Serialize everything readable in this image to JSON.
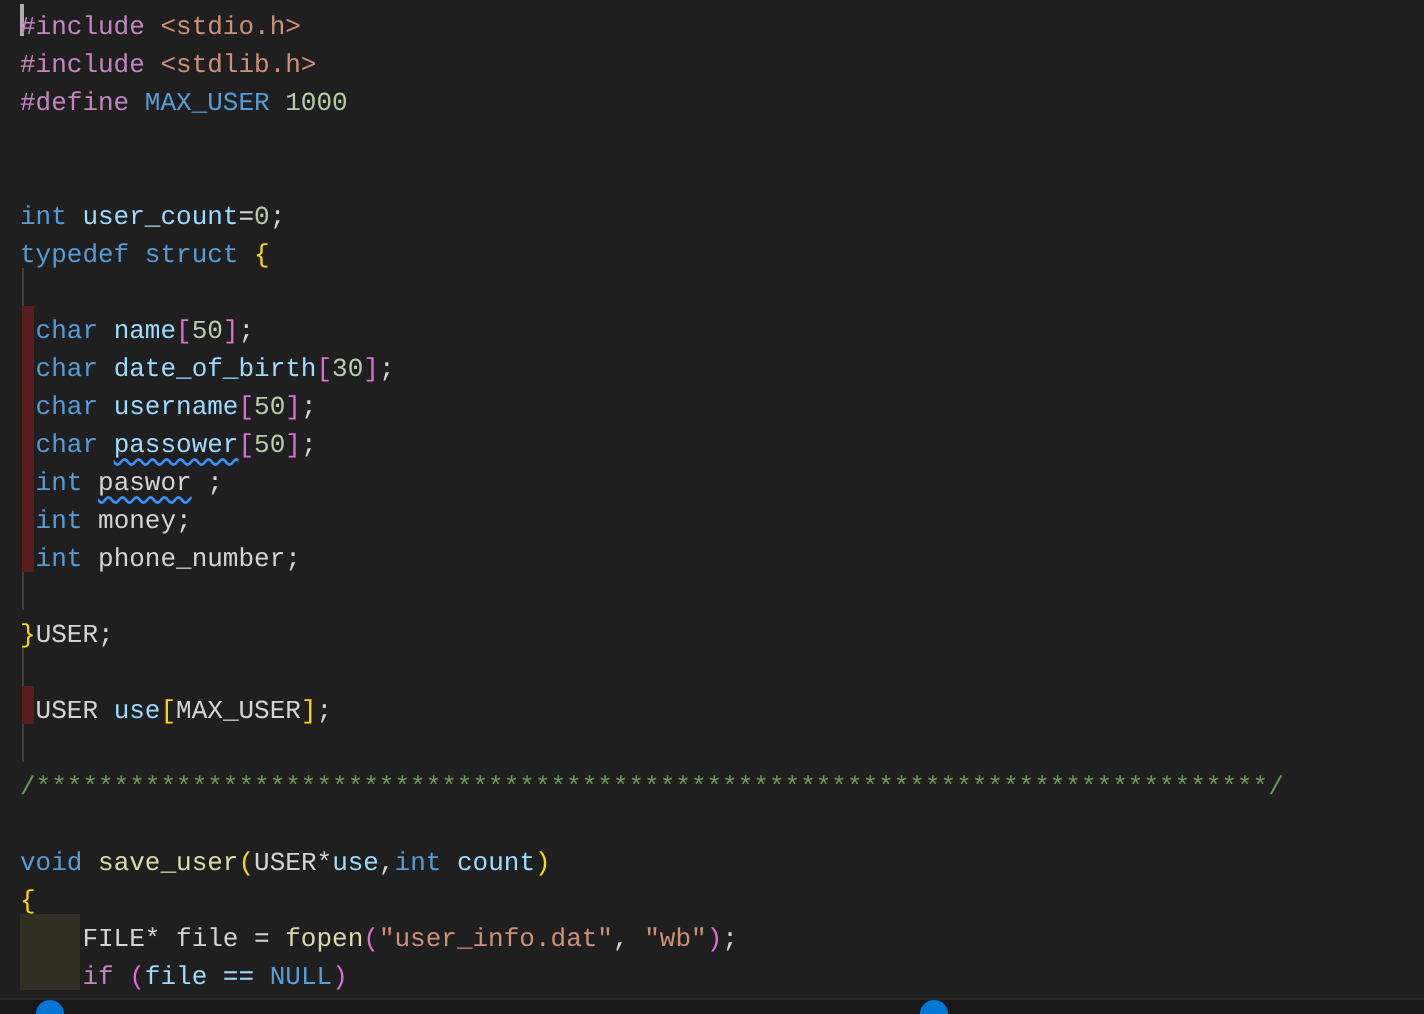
{
  "editor": {
    "lines": [
      {
        "kind": "code",
        "current": true,
        "tokens": [
          {
            "t": "#include",
            "kind": "pp"
          },
          {
            "t": " <stdio.h>",
            "kind": "str"
          }
        ]
      },
      {
        "kind": "code",
        "tokens": [
          {
            "t": "#include",
            "kind": "pp"
          },
          {
            "t": " <stdlib.h>",
            "kind": "str"
          }
        ]
      },
      {
        "kind": "code",
        "tokens": [
          {
            "t": "#define",
            "kind": "pp"
          },
          {
            "t": " MAX_USER",
            "kind": "macro"
          },
          {
            "t": " 1000",
            "kind": "num"
          }
        ]
      },
      {
        "kind": "blank"
      },
      {
        "kind": "blank"
      },
      {
        "kind": "code",
        "tokens": [
          {
            "t": "int",
            "kind": "kw"
          },
          {
            "t": " user_count",
            "kind": "id"
          },
          {
            "t": "=",
            "kind": "plain"
          },
          {
            "t": "0",
            "kind": "num"
          },
          {
            "t": ";",
            "kind": "plain"
          }
        ]
      },
      {
        "kind": "code",
        "tokens": [
          {
            "t": "typedef",
            "kind": "kw"
          },
          {
            "t": " struct",
            "kind": "kw"
          },
          {
            "t": " {",
            "kind": "br1"
          }
        ]
      },
      {
        "kind": "blank",
        "guide": true
      },
      {
        "kind": "code",
        "guide": true,
        "modified": true,
        "tokens": [
          {
            "t": " char",
            "kind": "kw"
          },
          {
            "t": " name",
            "kind": "id"
          },
          {
            "t": "[",
            "kind": "br2"
          },
          {
            "t": "50",
            "kind": "num"
          },
          {
            "t": "]",
            "kind": "br2"
          },
          {
            "t": ";",
            "kind": "plain"
          }
        ]
      },
      {
        "kind": "code",
        "guide": true,
        "modified": true,
        "tokens": [
          {
            "t": " char",
            "kind": "kw"
          },
          {
            "t": " date_of_birth",
            "kind": "id"
          },
          {
            "t": "[",
            "kind": "br2"
          },
          {
            "t": "30",
            "kind": "num"
          },
          {
            "t": "]",
            "kind": "br2"
          },
          {
            "t": ";",
            "kind": "plain"
          }
        ]
      },
      {
        "kind": "code",
        "guide": true,
        "modified": true,
        "tokens": [
          {
            "t": " char",
            "kind": "kw"
          },
          {
            "t": " username",
            "kind": "id"
          },
          {
            "t": "[",
            "kind": "br2"
          },
          {
            "t": "50",
            "kind": "num"
          },
          {
            "t": "]",
            "kind": "br2"
          },
          {
            "t": ";",
            "kind": "plain"
          }
        ]
      },
      {
        "kind": "code",
        "guide": true,
        "modified": true,
        "tokens": [
          {
            "t": " char ",
            "kind": "kw"
          },
          {
            "t": "passower",
            "kind": "id",
            "squiggle": true
          },
          {
            "t": "[",
            "kind": "br2"
          },
          {
            "t": "50",
            "kind": "num"
          },
          {
            "t": "]",
            "kind": "br2"
          },
          {
            "t": ";",
            "kind": "plain"
          }
        ]
      },
      {
        "kind": "code",
        "guide": true,
        "modified": true,
        "tokens": [
          {
            "t": " int ",
            "kind": "kw"
          },
          {
            "t": "paswor",
            "kind": "plain",
            "squiggle": true
          },
          {
            "t": " ;",
            "kind": "plain"
          }
        ]
      },
      {
        "kind": "code",
        "guide": true,
        "modified": true,
        "tokens": [
          {
            "t": " int",
            "kind": "kw"
          },
          {
            "t": " money;",
            "kind": "plain"
          }
        ]
      },
      {
        "kind": "code",
        "guide": true,
        "modified": true,
        "tokens": [
          {
            "t": " int",
            "kind": "kw"
          },
          {
            "t": " phone_number;",
            "kind": "plain"
          }
        ]
      },
      {
        "kind": "blank",
        "guide": true
      },
      {
        "kind": "code",
        "tokens": [
          {
            "t": "}",
            "kind": "br1"
          },
          {
            "t": "USER;",
            "kind": "plain"
          }
        ]
      },
      {
        "kind": "blank",
        "guide": true
      },
      {
        "kind": "code",
        "guide": true,
        "modified": true,
        "tokens": [
          {
            "t": " USER",
            "kind": "plain"
          },
          {
            "t": " use",
            "kind": "id"
          },
          {
            "t": "[",
            "kind": "br1"
          },
          {
            "t": "MAX_USER",
            "kind": "plain"
          },
          {
            "t": "]",
            "kind": "br1"
          },
          {
            "t": ";",
            "kind": "plain"
          }
        ]
      },
      {
        "kind": "blank",
        "guide": true
      },
      {
        "kind": "code",
        "tokens": [
          {
            "t": "/*******************************************************************************/",
            "kind": "cmt"
          }
        ]
      },
      {
        "kind": "blank"
      },
      {
        "kind": "code",
        "tokens": [
          {
            "t": "void",
            "kind": "kw"
          },
          {
            "t": " save_user",
            "kind": "fn"
          },
          {
            "t": "(",
            "kind": "br1"
          },
          {
            "t": "USER*",
            "kind": "plain"
          },
          {
            "t": "use",
            "kind": "id"
          },
          {
            "t": ",",
            "kind": "plain"
          },
          {
            "t": "int",
            "kind": "kw"
          },
          {
            "t": " count",
            "kind": "id"
          },
          {
            "t": ")",
            "kind": "br1"
          }
        ]
      },
      {
        "kind": "code",
        "tokens": [
          {
            "t": "{",
            "kind": "br1"
          }
        ]
      },
      {
        "kind": "code",
        "highlight": true,
        "tokens": [
          {
            "t": "    FILE* file = ",
            "kind": "plain"
          },
          {
            "t": "fopen",
            "kind": "fn"
          },
          {
            "t": "(",
            "kind": "br2"
          },
          {
            "t": "\"user_info.dat\"",
            "kind": "str"
          },
          {
            "t": ", ",
            "kind": "plain"
          },
          {
            "t": "\"wb\"",
            "kind": "str"
          },
          {
            "t": ")",
            "kind": "br2"
          },
          {
            "t": ";",
            "kind": "plain"
          }
        ]
      },
      {
        "kind": "code",
        "highlight": true,
        "tokens": [
          {
            "t": "    if ",
            "kind": "pp"
          },
          {
            "t": "(",
            "kind": "br2"
          },
          {
            "t": "file == ",
            "kind": "id"
          },
          {
            "t": "NULL",
            "kind": "macro"
          },
          {
            "t": ")",
            "kind": "br2"
          }
        ]
      }
    ]
  }
}
